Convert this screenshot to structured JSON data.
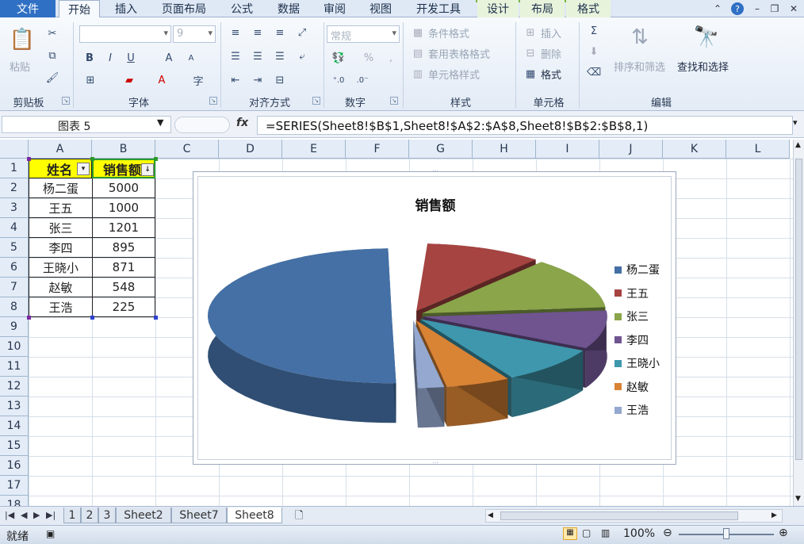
{
  "tabs": {
    "file": "文件",
    "items": [
      "开始",
      "插入",
      "页面布局",
      "公式",
      "数据",
      "审阅",
      "视图",
      "开发工具"
    ],
    "context": [
      "设计",
      "布局",
      "格式"
    ]
  },
  "ribbon": {
    "clipboard": {
      "paste": "粘贴",
      "label": "剪贴板"
    },
    "font": {
      "name": "",
      "size": "9",
      "bold": "B",
      "italic": "I",
      "underline": "U",
      "label": "字体"
    },
    "alignment": {
      "label": "对齐方式"
    },
    "number": {
      "format": "常规",
      "percent": "%",
      "comma": ",",
      "label": "数字"
    },
    "styles": {
      "conditional": "条件格式",
      "table": "套用表格格式",
      "cell": "单元格样式",
      "label": "样式"
    },
    "cells": {
      "insert": "插入",
      "delete": "删除",
      "format": "格式",
      "label": "单元格"
    },
    "editing": {
      "sort": "排序和筛选",
      "find": "查找和选择",
      "sum": "Σ",
      "label": "编辑"
    }
  },
  "formula_bar": {
    "name_box": "图表 5",
    "fx": "fx",
    "formula": "=SERIES(Sheet8!$B$1,Sheet8!$A$2:$A$8,Sheet8!$B$2:$B$8,1)"
  },
  "columns": [
    "A",
    "B",
    "C",
    "D",
    "E",
    "F",
    "G",
    "H",
    "I",
    "J",
    "K",
    "L"
  ],
  "rows": [
    "1",
    "2",
    "3",
    "4",
    "5",
    "6",
    "7",
    "8",
    "9",
    "10",
    "11",
    "12",
    "13",
    "14",
    "15",
    "16",
    "17",
    "18"
  ],
  "table": {
    "headers": [
      "姓名",
      "销售额"
    ],
    "rows": [
      {
        "name": "杨二蛋",
        "value": "5000"
      },
      {
        "name": "王五",
        "value": "1000"
      },
      {
        "name": "张三",
        "value": "1201"
      },
      {
        "name": "李四",
        "value": "895"
      },
      {
        "name": "王晓小",
        "value": "871"
      },
      {
        "name": "赵敏",
        "value": "548"
      },
      {
        "name": "王浩",
        "value": "225"
      }
    ]
  },
  "chart_data": {
    "type": "pie",
    "title": "销售额",
    "categories": [
      "杨二蛋",
      "王五",
      "张三",
      "李四",
      "王晓小",
      "赵敏",
      "王浩"
    ],
    "values": [
      5000,
      1000,
      1201,
      895,
      871,
      548,
      225
    ],
    "colors": [
      "#4470a5",
      "#a54441",
      "#8aa54a",
      "#6f5490",
      "#3e97ad",
      "#d98335",
      "#94a8d0"
    ],
    "legend": "right",
    "style": "3d-exploded"
  },
  "sheets": {
    "tabs": [
      "1",
      "2",
      "3",
      "Sheet2",
      "Sheet7",
      "Sheet8"
    ],
    "active": "Sheet8"
  },
  "status": {
    "ready": "就绪",
    "zoom": "100%"
  }
}
